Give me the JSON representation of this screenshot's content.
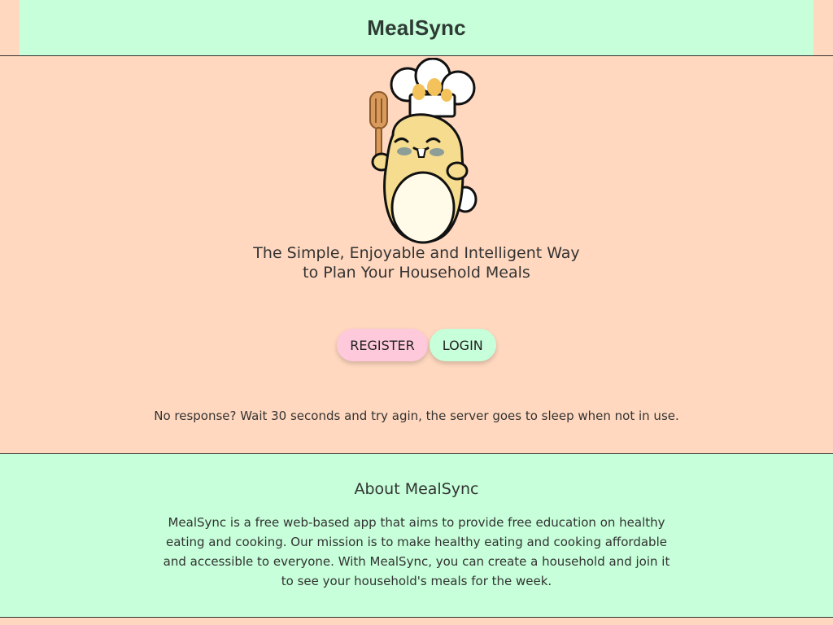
{
  "header": {
    "brand": "MealSync"
  },
  "hero": {
    "mascot_icon": "chef-bunny-mascot-icon",
    "tagline_line1": "The Simple, Enjoyable and Intelligent Way",
    "tagline_line2": "to Plan Your Household Meals",
    "register_label": "REGISTER",
    "login_label": "LOGIN",
    "notice": "No response? Wait 30 seconds and try agin, the server goes to sleep when not in use."
  },
  "about": {
    "title": "About MealSync",
    "text": "MealSync is a free web-based app that aims to provide free education on healthy eating and cooking. Our mission is to make healthy eating and cooking affordable and accessible to everyone. With MealSync, you can create a household and join it to see your household's meals for the week."
  },
  "colors": {
    "peach_background": "#ffd8bf",
    "mint_accent": "#c6ffd9",
    "pink_button": "#ffc9dc",
    "text": "#333333"
  }
}
